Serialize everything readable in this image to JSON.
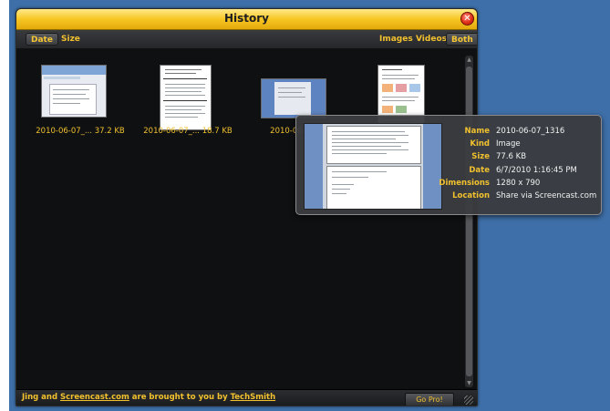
{
  "window": {
    "title": "History"
  },
  "toolbar": {
    "sort_date": "Date",
    "sort_size": "Size",
    "filter_images": "Images",
    "filter_videos": "Videos",
    "filter_both": "Both"
  },
  "items": [
    {
      "label": "2010-06-07_... 37.2 KB"
    },
    {
      "label": "2010-06-07_... 18.7 KB"
    },
    {
      "label": "2010-06-07_"
    },
    {
      "label": ""
    }
  ],
  "tooltip": {
    "rows": [
      {
        "key": "Name",
        "value": "2010-06-07_1316"
      },
      {
        "key": "Kind",
        "value": "Image"
      },
      {
        "key": "Size",
        "value": "77.6 KB"
      },
      {
        "key": "Date",
        "value": "6/7/2010 1:16:45 PM"
      },
      {
        "key": "Dimensions",
        "value": "1280 x 790"
      },
      {
        "key": "Location",
        "value": "Share via Screencast.com"
      }
    ]
  },
  "footer": {
    "text_pre": "Jing and ",
    "link_screencast": "Screencast.com",
    "text_mid": " are brought to you by ",
    "link_techsmith": "TechSmith",
    "go_pro": "Go Pro!"
  },
  "colors": {
    "accent": "#f2c12e",
    "titlebar": "#f7c623",
    "desktop": "#3e6fa8",
    "panel": "#0f1012"
  }
}
